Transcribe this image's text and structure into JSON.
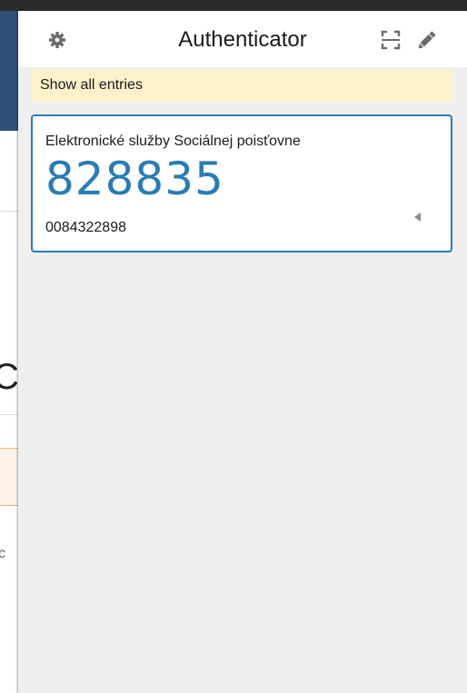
{
  "app": {
    "title": "Authenticator"
  },
  "header": {
    "settings_icon": "gear-icon",
    "scan_icon": "scan-qr-icon",
    "edit_icon": "pencil-icon"
  },
  "notice": {
    "label": "Show all entries"
  },
  "entries": [
    {
      "issuer": "Elektronické služby Sociálnej poisťovne",
      "code": "828835",
      "account": "0084322898",
      "menu_icon": "triangle-left-icon"
    }
  ],
  "colors": {
    "accent": "#2a7bb4",
    "notice_bg": "#fcf1cb",
    "popup_bg": "#efefef"
  }
}
